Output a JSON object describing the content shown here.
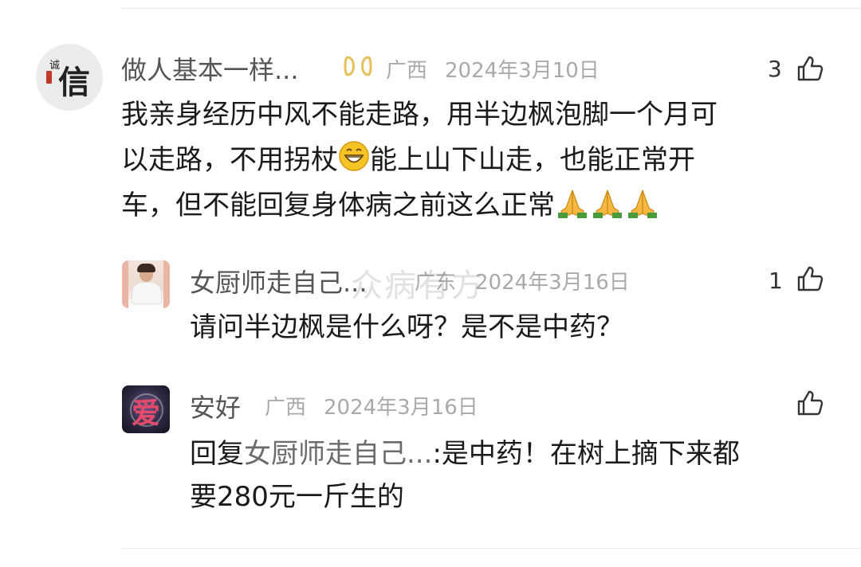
{
  "comments": [
    {
      "user": "做人基本一样...",
      "badge_icon": "ribbon-icon",
      "location": "广西",
      "date": "2024年3月10日",
      "likes": "3",
      "content_lines": [
        "我亲身经历中风不能走路，用半边枫泡脚一个月可",
        "以走路，不用拐杖",
        "能上山下山走，也能正常开",
        "车，但不能回复身体病之前这么正常"
      ],
      "avatar_text": "信",
      "avatar_small_text": "诚"
    },
    {
      "user": "女厨师走自己...",
      "location": "广东",
      "date": "2024年3月16日",
      "likes": "1",
      "content": "请问半边枫是什么呀？是不是中药？"
    },
    {
      "user": "安好",
      "location": "广西",
      "date": "2024年3月16日",
      "likes": "",
      "reply_prefix": "回复",
      "reply_target": "女厨师走自己...",
      "content_line1": ":是中药！在树上摘下来都",
      "content_line2": "要280元一斤生的",
      "avatar_text": "爱"
    }
  ],
  "watermark": "众病有方",
  "emoji": {
    "grin": "grinning-face-icon",
    "pray": "folded-hands-icon"
  },
  "colors": {
    "text": "#1a1a1a",
    "muted": "#aaaaaa",
    "name": "#555555",
    "badge": "#e8c15a"
  }
}
